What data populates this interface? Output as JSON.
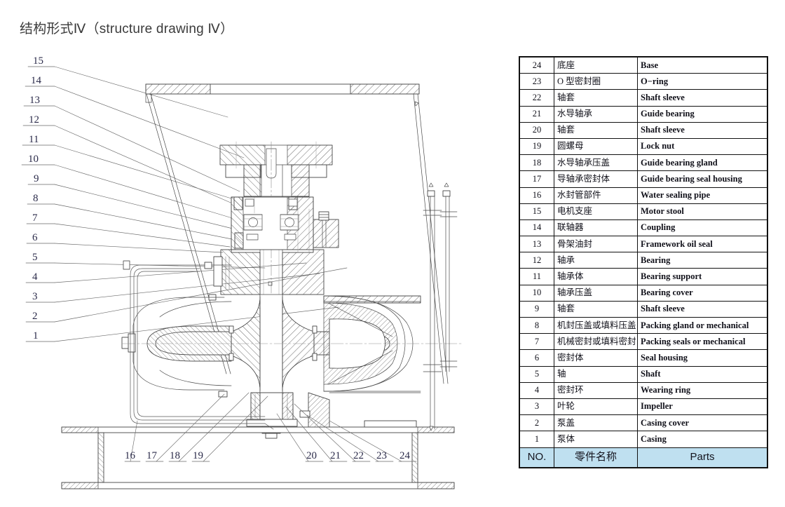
{
  "page": {
    "title": "结构形式Ⅳ（structure drawing Ⅳ）"
  },
  "drawing": {
    "name": "vertical-pump-cross-section",
    "left_callouts": [
      "15",
      "14",
      "13",
      "12",
      "11",
      "10",
      "9",
      "8",
      "7",
      "6",
      "5",
      "4",
      "3",
      "2",
      "1"
    ],
    "bottom_callouts": [
      "16",
      "17",
      "18",
      "19",
      "20",
      "21",
      "22",
      "23",
      "24"
    ]
  },
  "parts_table": {
    "header": {
      "no": "NO.",
      "cn": "零件名称",
      "en": "Parts",
      "background": "#bfe0f0"
    },
    "rows": [
      {
        "no": "24",
        "cn": "底座",
        "en": "Base"
      },
      {
        "no": "23",
        "cn": "O 型密封圈",
        "en": "O−ring"
      },
      {
        "no": "22",
        "cn": "轴套",
        "en": "Shaft sleeve"
      },
      {
        "no": "21",
        "cn": "水导轴承",
        "en": "Guide bearing"
      },
      {
        "no": "20",
        "cn": "轴套",
        "en": "Shaft sleeve"
      },
      {
        "no": "19",
        "cn": "圆螺母",
        "en": "Lock nut"
      },
      {
        "no": "18",
        "cn": "水导轴承压盖",
        "en": "Guide bearing gland"
      },
      {
        "no": "17",
        "cn": "导轴承密封体",
        "en": "Guide bearing seal housing"
      },
      {
        "no": "16",
        "cn": "水封管部件",
        "en": "Water sealing pipe"
      },
      {
        "no": "15",
        "cn": "电机支座",
        "en": "Motor stool"
      },
      {
        "no": "14",
        "cn": "联轴器",
        "en": "Coupling"
      },
      {
        "no": "13",
        "cn": "骨架油封",
        "en": "Framework oil seal"
      },
      {
        "no": "12",
        "cn": "轴承",
        "en": "Bearing"
      },
      {
        "no": "11",
        "cn": "轴承体",
        "en": "Bearing support"
      },
      {
        "no": "10",
        "cn": "轴承压盖",
        "en": "Bearing cover"
      },
      {
        "no": "9",
        "cn": "轴套",
        "en": "Shaft sleeve"
      },
      {
        "no": "8",
        "cn": "机封压盖或填料压盖",
        "en": "Packing gland or mechanical"
      },
      {
        "no": "7",
        "cn": "机械密封或填料密封",
        "en": "Packing seals or mechanical"
      },
      {
        "no": "6",
        "cn": "密封体",
        "en": "Seal housing"
      },
      {
        "no": "5",
        "cn": "轴",
        "en": "Shaft"
      },
      {
        "no": "4",
        "cn": "密封环",
        "en": "Wearing ring"
      },
      {
        "no": "3",
        "cn": "叶轮",
        "en": "Impeller"
      },
      {
        "no": "2",
        "cn": "泵盖",
        "en": "Casing cover"
      },
      {
        "no": "1",
        "cn": "泵体",
        "en": "Casing"
      }
    ]
  }
}
